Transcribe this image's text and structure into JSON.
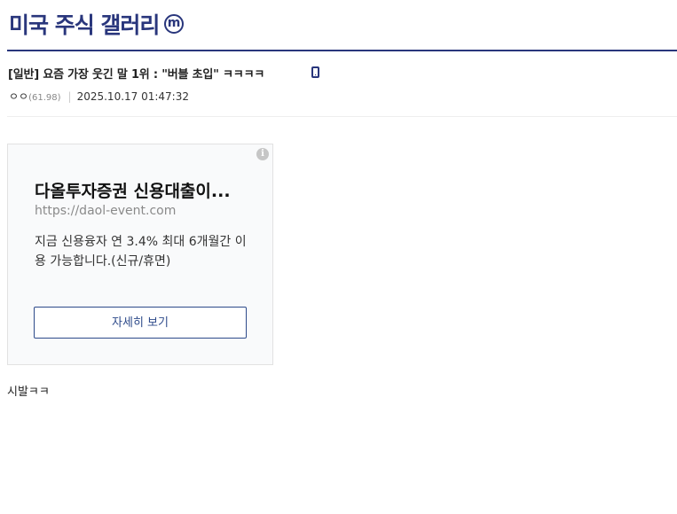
{
  "gallery": {
    "title": "미국 주식 갤러리",
    "badge": "m"
  },
  "post": {
    "title": "[일반] 요즘 가장 웃긴 말 1위 : \"버블 초입\" ㅋㅋㅋㅋ",
    "author": "ㅇㅇ",
    "author_ip": "(61.98)",
    "separator": "|",
    "date": "2025.10.17 01:47:32",
    "body": "시발ㅋㅋ"
  },
  "ad": {
    "headline": "다올투자증권 신용대출이...",
    "url": "https://daol-event.com",
    "body": "지금 신용융자 연 3.4% 최대 6개월간 이용 가능합니다.(신규/휴면)",
    "button_label": "자세히 보기",
    "info_icon": "i"
  },
  "icons": {
    "badge": "minor-gallery-badge-icon",
    "mobile": "mobile-phone-icon",
    "ad_info": "info-icon"
  },
  "colors": {
    "brand": "#29367c",
    "ad_button": "#2d4a8a",
    "ad_background": "#f9fafb"
  }
}
